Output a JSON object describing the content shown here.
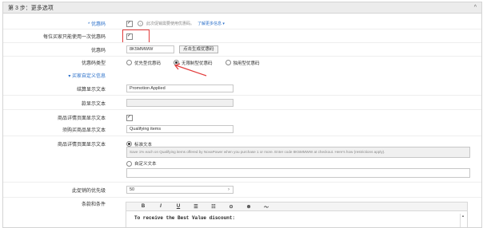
{
  "header": {
    "title": "第 3 步：更多选项",
    "chevron": "^"
  },
  "rows": {
    "coupon": {
      "label": "* 优惠码",
      "help_text": "此次促销需要使用优惠码。",
      "help_link": "了解更多信息 ▾"
    },
    "once_per_buyer": {
      "label": "每位买家只能使用一次优惠码"
    },
    "coupon_code": {
      "label": "优惠码",
      "value": "8K5MMWW",
      "button": "点击生成优惠码"
    },
    "coupon_type": {
      "label": "优惠码类型",
      "options": [
        "优先型优惠码",
        "无限制型优惠码",
        "独用型优惠码"
      ],
      "selected_index": 1
    },
    "custom_section": {
      "label": "▾ 买家自定义信息"
    },
    "checkout_text": {
      "label": "结算显示文本",
      "value": "Promotion Applied"
    },
    "short_text": {
      "label": "款显示文本",
      "value": ""
    },
    "detail_page": {
      "label": "商品详情页面显示文本"
    },
    "qualifying": {
      "label": "须购买商品显示文本",
      "value": "Qualifying items"
    },
    "detail_text": {
      "label": "商品详情页面显示文本",
      "option_standard": "标准文本",
      "standard_text": "Save 1% each on Qualifying items offered by NovaPower when you purchase 1 or more. Enter code 8K5MMWW at checkout. Here's how (restrictions apply).",
      "option_custom": "自定义文本",
      "custom_value": ""
    },
    "priority": {
      "label": "此促销的优先级",
      "value": "50",
      "caret": "›"
    },
    "terms": {
      "label": "条款和条件"
    }
  },
  "editor": {
    "toolbar": [
      "B",
      "I",
      "U",
      "☰",
      "☷",
      "⊙",
      "⊗",
      "〜"
    ],
    "body_text": "To receive the Best Value discount:",
    "scroll_up": "▲"
  },
  "colors": {
    "annotation_red": "#e23b3b",
    "link_blue": "#2a6fc9"
  }
}
